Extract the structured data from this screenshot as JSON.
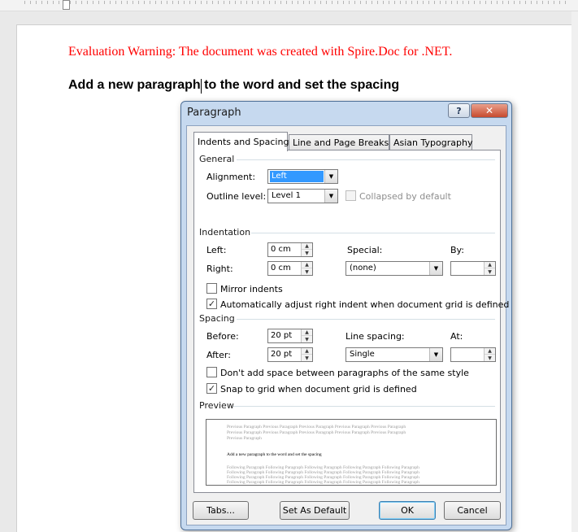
{
  "document": {
    "warning": "Evaluation Warning: The document was created with Spire.Doc for .NET.",
    "heading": "Add a new paragraph to the word and set the spacing"
  },
  "dialog": {
    "title": "Paragraph",
    "help_glyph": "?",
    "close_glyph": "✕",
    "tabs": [
      {
        "label": "Indents and Spacing",
        "active": true
      },
      {
        "label": "Line and Page Breaks",
        "active": false
      },
      {
        "label": "Asian Typography",
        "active": false
      }
    ],
    "general": {
      "label": "General",
      "alignment_label": "Alignment:",
      "alignment_value": "Left",
      "outline_label": "Outline level:",
      "outline_value": "Level 1",
      "collapsed_label": "Collapsed by default",
      "collapsed_checked": false
    },
    "indentation": {
      "label": "Indentation",
      "left_label": "Left:",
      "left_value": "0 cm",
      "right_label": "Right:",
      "right_value": "0 cm",
      "special_label": "Special:",
      "special_value": "(none)",
      "by_label": "By:",
      "by_value": "",
      "mirror_label": "Mirror indents",
      "mirror_checked": false,
      "auto_adjust_label": "Automatically adjust right indent when document grid is defined",
      "auto_adjust_checked": true
    },
    "spacing": {
      "label": "Spacing",
      "before_label": "Before:",
      "before_value": "20 pt",
      "after_label": "After:",
      "after_value": "20 pt",
      "line_spacing_label": "Line spacing:",
      "line_spacing_value": "Single",
      "at_label": "At:",
      "at_value": "",
      "dont_add_label": "Don't add space between paragraphs of the same style",
      "dont_add_checked": false,
      "snap_label": "Snap to grid when document grid is defined",
      "snap_checked": true
    },
    "preview": {
      "label": "Preview",
      "previous_lines": [
        "Previous Paragraph Previous Paragraph Previous Paragraph Previous Paragraph Previous Paragraph",
        "Previous Paragraph Previous Paragraph Previous Paragraph Previous Paragraph Previous Paragraph",
        "Previous Paragraph"
      ],
      "current_text": "Add a new paragraph to the word and set the spacing",
      "following_lines": [
        "Following Paragraph Following Paragraph Following Paragraph Following Paragraph Following Paragraph",
        "Following Paragraph Following Paragraph Following Paragraph Following Paragraph Following Paragraph",
        "Following Paragraph Following Paragraph Following Paragraph Following Paragraph Following Paragraph",
        "Following Paragraph Following Paragraph Following Paragraph Following Paragraph Following Paragraph"
      ]
    },
    "buttons": {
      "tabs": "Tabs...",
      "set_default": "Set As Default",
      "ok": "OK",
      "cancel": "Cancel"
    },
    "glyphs": {
      "check": "✓",
      "arrow_down": "▼",
      "spin_up": "▲",
      "spin_down": "▼"
    }
  }
}
